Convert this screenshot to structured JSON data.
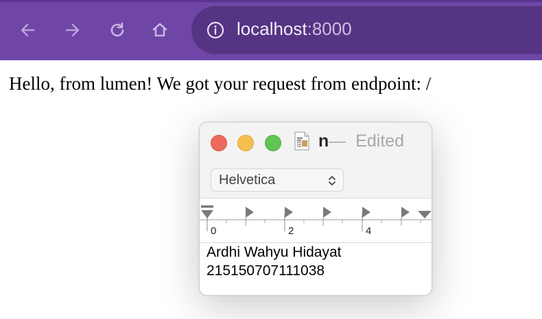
{
  "browser": {
    "url_host": "localhost",
    "url_port": ":8000",
    "colors": {
      "toolbar": "#6f45a6",
      "address_bar": "#553484"
    }
  },
  "page": {
    "message": "Hello, from lumen! We got your request from endpoint: /"
  },
  "textedit": {
    "filename": "n",
    "dash": "—",
    "status": "Edited",
    "font": "Helvetica",
    "ruler_labels": [
      "0",
      "2",
      "4"
    ],
    "lines": [
      "Ardhi Wahyu Hidayat",
      "215150707111038"
    ]
  }
}
